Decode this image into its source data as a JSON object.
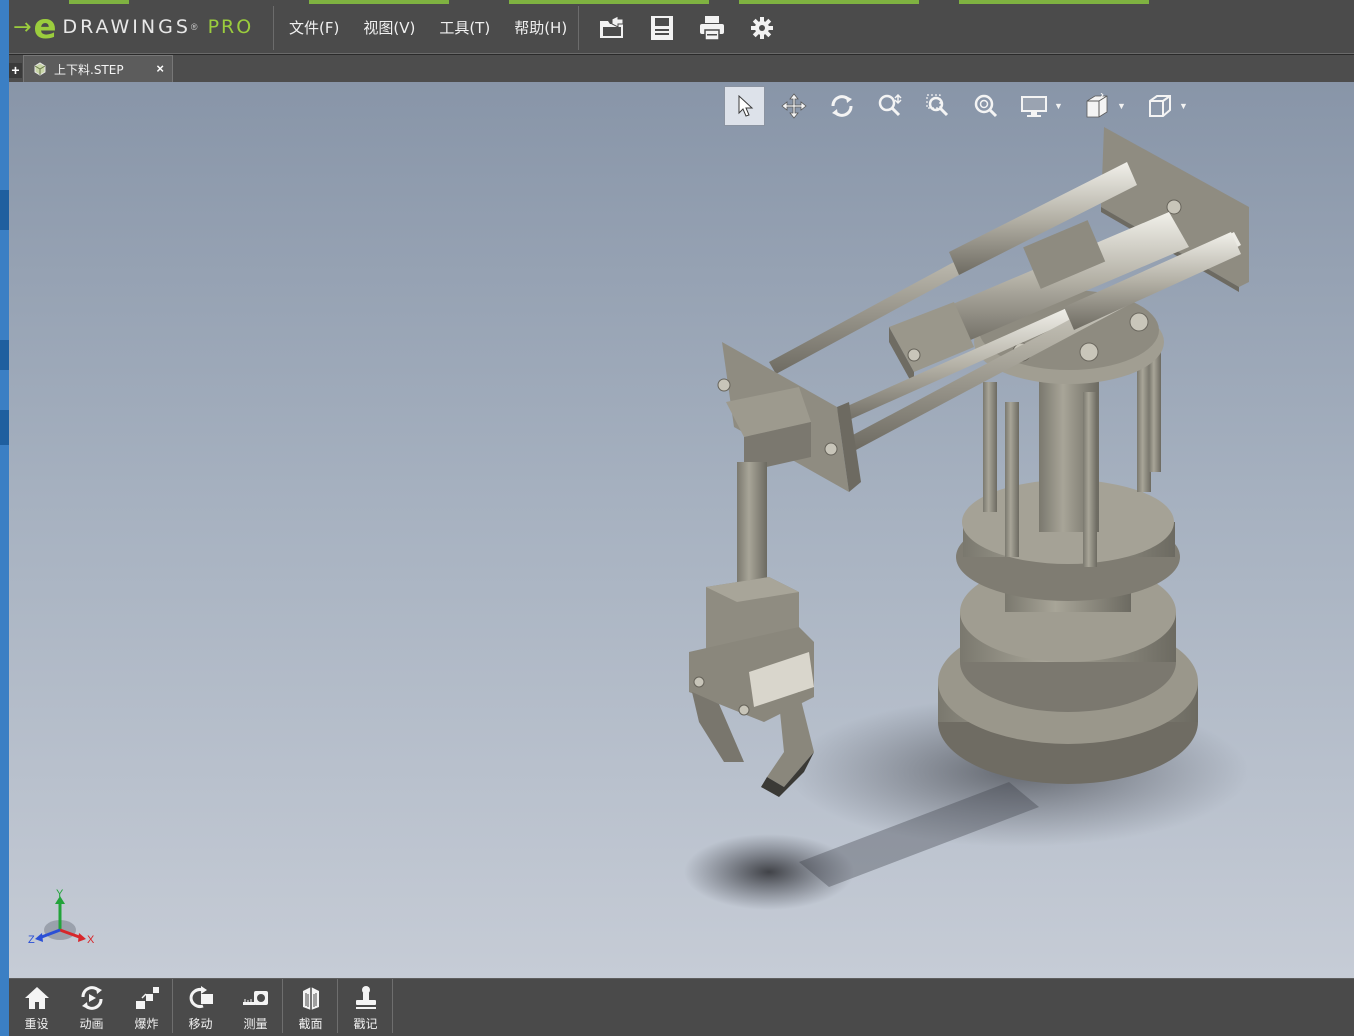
{
  "app": {
    "logo_prefix": "e",
    "logo_name": "DRAWINGS",
    "logo_suffix": "PRO",
    "brand_color": "#9bcd3d"
  },
  "menu": {
    "items": [
      {
        "label": "文件(F)"
      },
      {
        "label": "视图(V)"
      },
      {
        "label": "工具(T)"
      },
      {
        "label": "帮助(H)"
      }
    ]
  },
  "quick_actions": [
    {
      "icon": "open-folder-icon"
    },
    {
      "icon": "save-icon"
    },
    {
      "icon": "print-icon"
    },
    {
      "icon": "settings-gear-icon"
    }
  ],
  "tabs": {
    "add_label": "+",
    "items": [
      {
        "label": "上下料.STEP",
        "close": "×",
        "active": true
      }
    ]
  },
  "view_toolbar": {
    "tools": [
      {
        "icon": "select-pointer-icon",
        "active": true
      },
      {
        "icon": "pan-move-icon"
      },
      {
        "icon": "rotate-icon"
      },
      {
        "icon": "zoom-icon"
      },
      {
        "icon": "zoom-area-icon"
      },
      {
        "icon": "zoom-fit-icon"
      },
      {
        "icon": "display-style-icon",
        "dropdown": true
      },
      {
        "icon": "view-orientation-icon",
        "dropdown": true
      },
      {
        "icon": "standard-view-cube-icon",
        "dropdown": true
      }
    ]
  },
  "triad": {
    "x_label": "X",
    "y_label": "Y",
    "z_label": "Z",
    "x_color": "#d8262a",
    "y_color": "#22a33a",
    "z_color": "#2a4fd6"
  },
  "bottom_toolbar": {
    "items": [
      {
        "label": "重设",
        "icon": "home-reset-icon"
      },
      {
        "label": "动画",
        "icon": "animate-icon"
      },
      {
        "label": "爆炸",
        "icon": "explode-icon"
      },
      {
        "label": "移动",
        "icon": "move-component-icon"
      },
      {
        "label": "测量",
        "icon": "measure-icon"
      },
      {
        "label": "截面",
        "icon": "section-icon"
      },
      {
        "label": "戳记",
        "icon": "stamp-icon"
      }
    ]
  },
  "colors": {
    "chrome": "#4b4b4b",
    "viewport_top": "#8895a8",
    "viewport_bottom": "#c6ccd6",
    "model_metal": "#8d8a7e"
  }
}
